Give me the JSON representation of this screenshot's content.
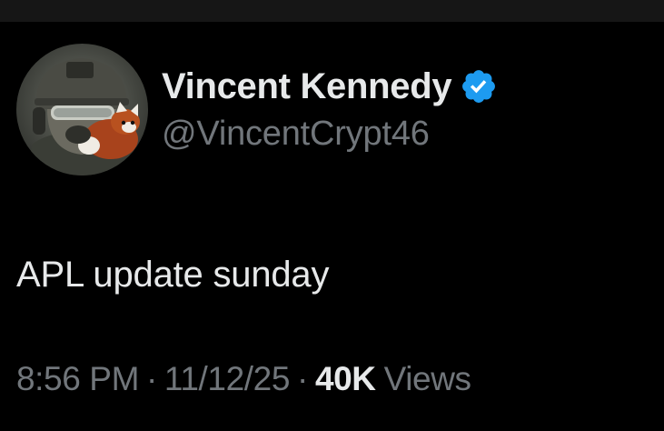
{
  "author": {
    "display_name": "Vincent Kennedy",
    "handle": "@VincentCrypt46",
    "verified": true,
    "verified_color": "#1d9bf0"
  },
  "tweet": {
    "text": "APL update sunday"
  },
  "meta": {
    "time": "8:56 PM",
    "separator": "·",
    "date": "11/12/25",
    "views_count": "40K",
    "views_label": "Views"
  },
  "colors": {
    "background": "#000000",
    "primary_text": "#e7e9ea",
    "secondary_text": "#71767b"
  },
  "icons": [
    "avatar-image",
    "verified-badge-icon"
  ]
}
